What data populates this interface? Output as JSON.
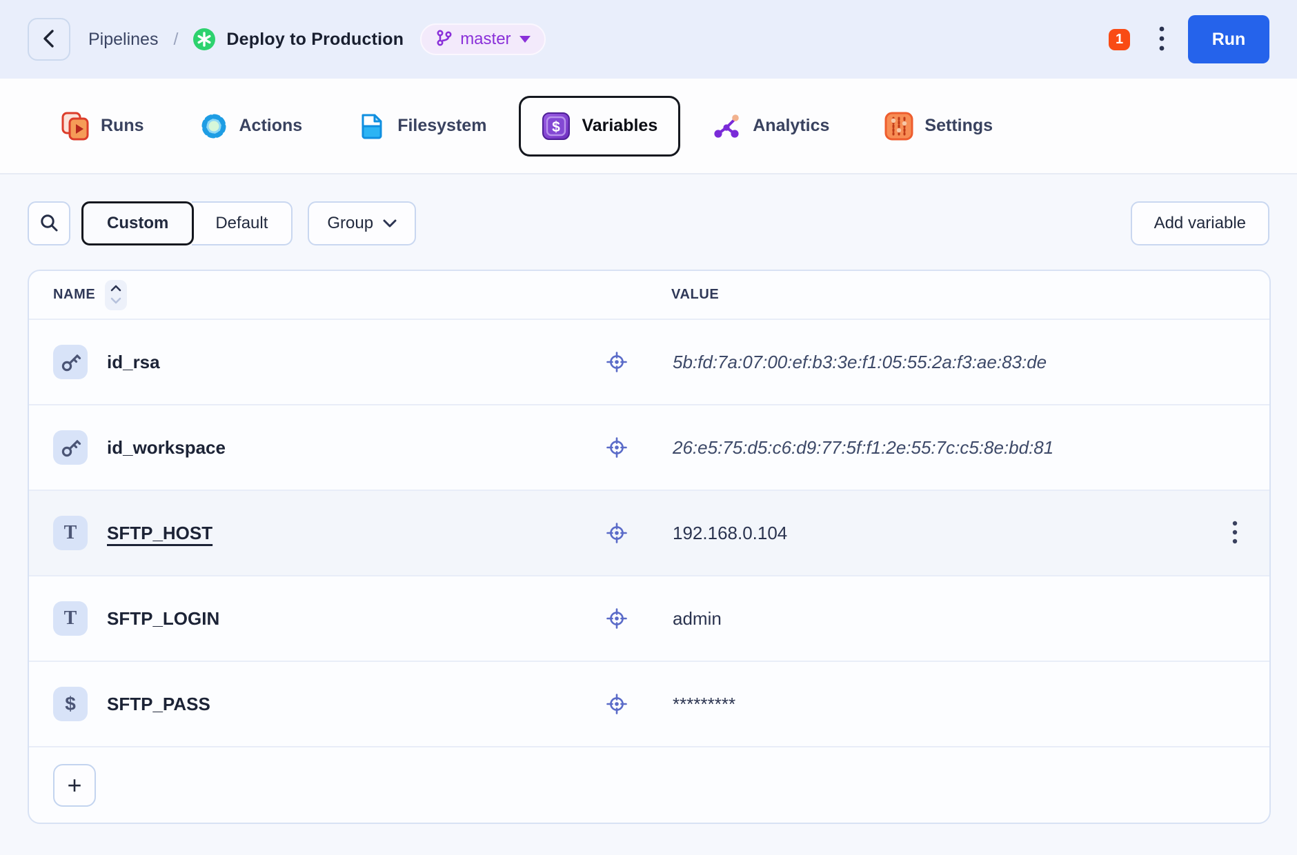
{
  "header": {
    "breadcrumb": "Pipelines",
    "separator": "/",
    "title": "Deploy to Production",
    "branch": {
      "label": "master",
      "icon": "git-branch-icon"
    },
    "badge_count": "1",
    "run_label": "Run",
    "accent_color": "#2563eb",
    "badge_color": "#f94b14",
    "branch_color": "#8a30d9"
  },
  "tabs": [
    {
      "label": "Runs",
      "icon": "runs-icon",
      "selected": false
    },
    {
      "label": "Actions",
      "icon": "actions-icon",
      "selected": false
    },
    {
      "label": "Filesystem",
      "icon": "filesystem-icon",
      "selected": false
    },
    {
      "label": "Variables",
      "icon": "variables-icon",
      "selected": true
    },
    {
      "label": "Analytics",
      "icon": "analytics-icon",
      "selected": false
    },
    {
      "label": "Settings",
      "icon": "settings-icon",
      "selected": false
    }
  ],
  "filters": {
    "search_icon": "search-icon",
    "segments": [
      {
        "label": "Custom",
        "selected": true
      },
      {
        "label": "Default",
        "selected": false
      }
    ],
    "group_label": "Group",
    "add_button_label": "Add variable"
  },
  "table": {
    "columns": {
      "name": "NAME",
      "value": "VALUE"
    },
    "rows": [
      {
        "icon": "ssh-key-icon",
        "glyph": "",
        "name": "id_rsa",
        "value": "5b:fd:7a:07:00:ef:b3:3e:f1:05:55:2a:f3:ae:83:de"
      },
      {
        "icon": "ssh-key-icon",
        "glyph": "",
        "name": "id_workspace",
        "value": "26:e5:75:d5:c6:d9:77:5f:f1:2e:55:7c:c5:8e:bd:81"
      },
      {
        "icon": "text-type-icon",
        "glyph": "T",
        "name": "SFTP_HOST",
        "value": "192.168.0.104"
      },
      {
        "icon": "text-type-icon",
        "glyph": "T",
        "name": "SFTP_LOGIN",
        "value": "admin"
      },
      {
        "icon": "secret-type-icon",
        "glyph": "$",
        "name": "SFTP_PASS",
        "value": "*********"
      }
    ],
    "add_row_label": "+"
  }
}
